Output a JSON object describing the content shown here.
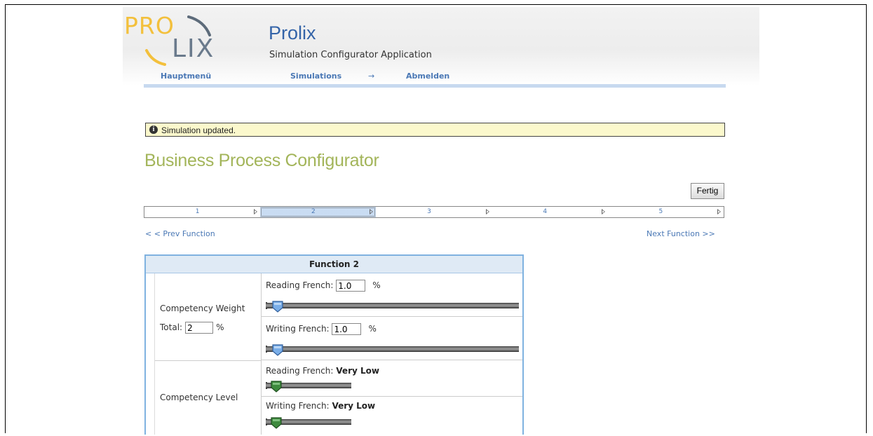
{
  "logo": {
    "top_text": "PRO",
    "bottom_text": "LIX"
  },
  "app": {
    "title": "Prolix",
    "subtitle": "Simulation Configurator Application"
  },
  "nav": {
    "items": [
      {
        "label": "Hauptmenü"
      },
      {
        "label": "Simulations"
      },
      {
        "label": "→"
      },
      {
        "label": "Abmelden"
      }
    ]
  },
  "message": {
    "icon": "info-icon",
    "text": "Simulation updated."
  },
  "page": {
    "title": "Business Process Configurator"
  },
  "toolbar": {
    "done_label": "Fertig"
  },
  "steps": {
    "active": 2,
    "items": [
      {
        "label": "1"
      },
      {
        "label": "2"
      },
      {
        "label": "3"
      },
      {
        "label": "4"
      },
      {
        "label": "5"
      }
    ]
  },
  "pager": {
    "prev_label": "< < Prev Function",
    "next_label": "Next Function >>"
  },
  "function_panel": {
    "title": "Function 2",
    "competency_weight": {
      "label": "Competency Weight",
      "total_label": "Total:",
      "total_value": "2",
      "unit": "%",
      "items": [
        {
          "label": "Reading French:",
          "value": "1.0",
          "unit": "%",
          "slider_level": 0.0
        },
        {
          "label": "Writing French:",
          "value": "1.0",
          "unit": "%",
          "slider_level": 0.0
        }
      ]
    },
    "competency_level": {
      "label": "Competency Level",
      "items": [
        {
          "label": "Reading French:",
          "value": "Very Low",
          "slider_level": 0.0
        },
        {
          "label": "Writing French:",
          "value": "Very Low",
          "slider_level": 0.0
        }
      ]
    }
  },
  "colors": {
    "accent_blue": "#3464a8",
    "link_blue": "#4a78b5",
    "title_green": "#a3b55a",
    "logo_yellow": "#f3c03c",
    "message_bg": "#fbf8cc",
    "panel_border": "#7fb2e0"
  }
}
